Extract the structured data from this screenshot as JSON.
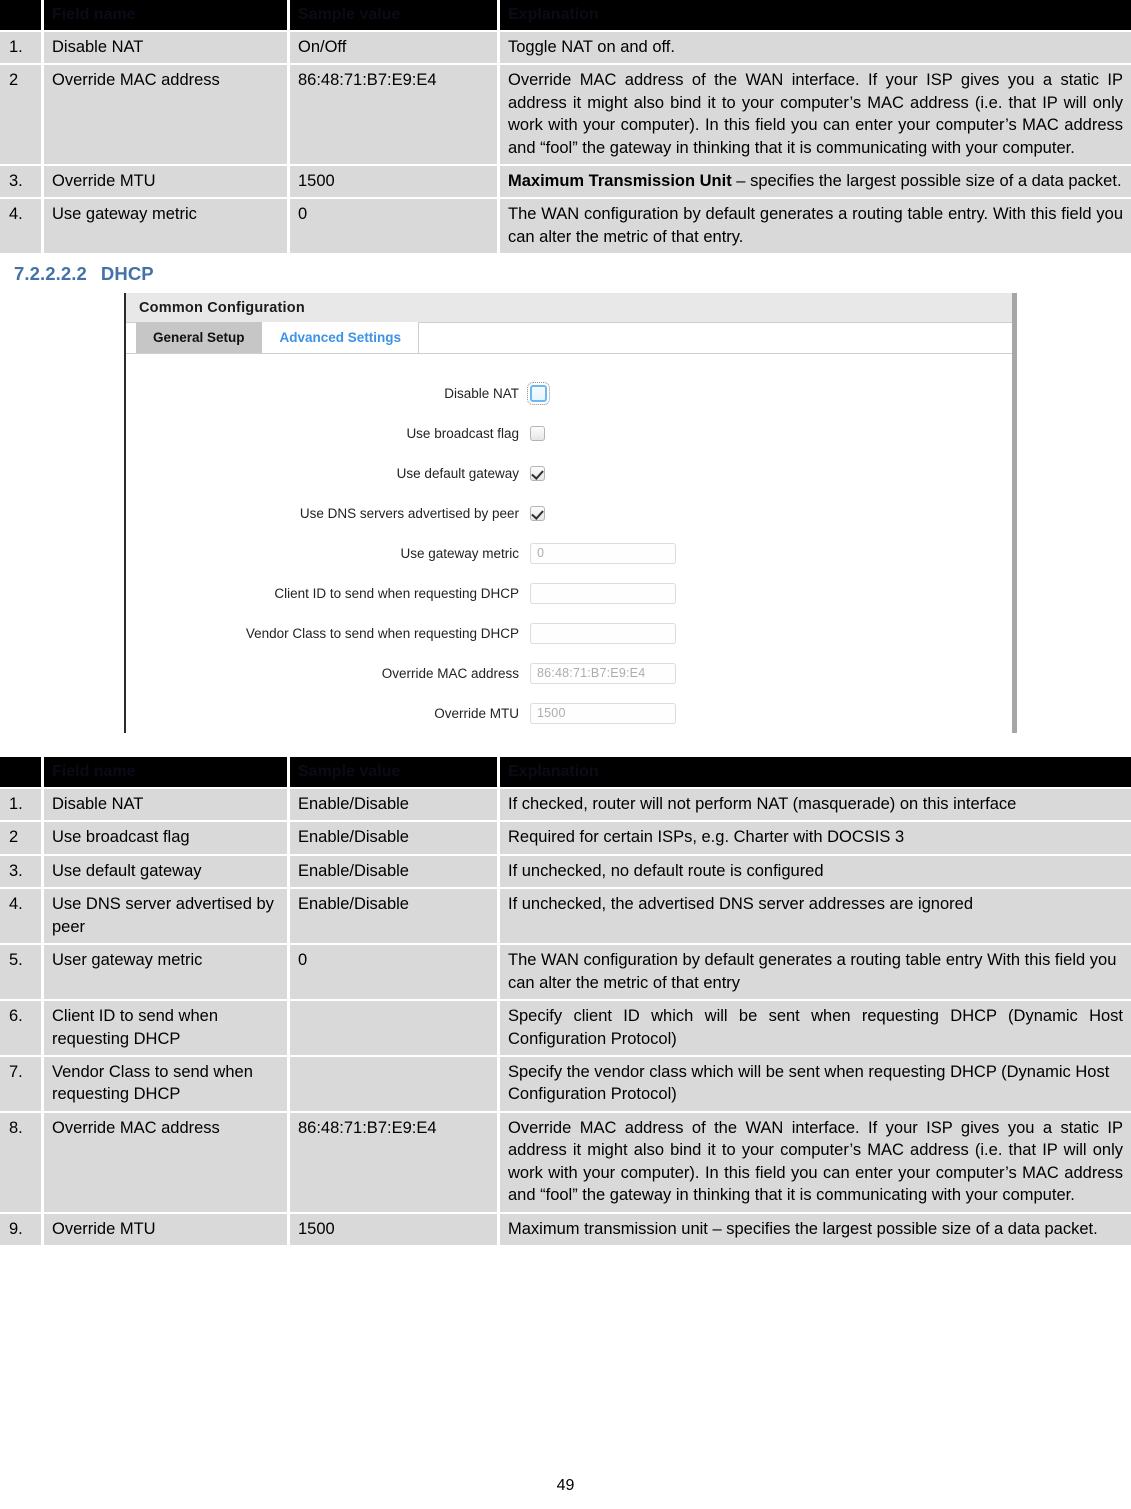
{
  "table_headers": {
    "num": "",
    "field_name": "Field name",
    "sample_value": "Sample value",
    "explanation": "Explanation"
  },
  "table_static": {
    "rows": [
      {
        "num": "1.",
        "field_name": "Disable NAT",
        "sample_value": "On/Off",
        "explanation": "Toggle NAT on and off."
      },
      {
        "num": "2",
        "field_name": "Override MAC address",
        "sample_value": "86:48:71:B7:E9:E4",
        "explanation": "Override MAC address of the WAN interface. If your ISP gives you a static IP address it might also bind it to your computer’s MAC address (i.e. that IP will only work with your computer). In this field you can enter your computer’s MAC address and “fool” the gateway in thinking that it is communicating with your computer."
      },
      {
        "num": "3.",
        "field_name": "Override MTU",
        "sample_value": "1500",
        "explanation_bold": "Maximum Transmission Unit",
        "explanation": " – specifies the largest possible size of a data packet."
      },
      {
        "num": "4.",
        "field_name": "Use gateway metric",
        "sample_value": "0",
        "explanation": "The WAN configuration by default generates a routing table entry. With this field you can alter the metric of that entry."
      }
    ]
  },
  "section": {
    "number": "7.2.2.2.2",
    "title": "DHCP",
    "heading_color": "#4472A8"
  },
  "screenshot": {
    "panel_title": "Common Configuration",
    "tabs": [
      {
        "label": "General Setup",
        "active": false
      },
      {
        "label": "Advanced Settings",
        "active": true
      }
    ],
    "active_tab_color": "#3b93e8",
    "fields": [
      {
        "label": "Disable NAT",
        "type": "checkbox",
        "checked": false,
        "focused": true
      },
      {
        "label": "Use broadcast flag",
        "type": "checkbox",
        "checked": false,
        "focused": false
      },
      {
        "label": "Use default gateway",
        "type": "checkbox",
        "checked": true,
        "focused": false
      },
      {
        "label": "Use DNS servers advertised by peer",
        "type": "checkbox",
        "checked": true,
        "focused": false
      },
      {
        "label": "Use gateway metric",
        "type": "text",
        "value": "0"
      },
      {
        "label": "Client ID to send when requesting DHCP",
        "type": "text",
        "value": ""
      },
      {
        "label": "Vendor Class to send when requesting DHCP",
        "type": "text",
        "value": ""
      },
      {
        "label": "Override MAC address",
        "type": "text",
        "value": "86:48:71:B7:E9:E4"
      },
      {
        "label": "Override MTU",
        "type": "text",
        "value": "1500"
      }
    ]
  },
  "table_dhcp": {
    "rows": [
      {
        "num": "1.",
        "field_name": "Disable NAT",
        "sample_value": "Enable/Disable",
        "explanation": "If checked, router will not perform NAT (masquerade) on this interface"
      },
      {
        "num": "2",
        "field_name": "Use broadcast flag",
        "sample_value": "Enable/Disable",
        "explanation": "Required for certain ISPs, e.g. Charter with DOCSIS 3"
      },
      {
        "num": "3.",
        "field_name": "Use default gateway",
        "sample_value": "Enable/Disable",
        "explanation": "If unchecked, no default route is configured"
      },
      {
        "num": "4.",
        "field_name": "Use DNS server advertised by peer",
        "sample_value": "Enable/Disable",
        "explanation": "If unchecked, the advertised DNS server addresses are ignored"
      },
      {
        "num": "5.",
        "field_name": "User gateway metric",
        "sample_value": "0",
        "explanation": "The WAN configuration by default generates a routing table entry With this field you can alter the metric of that entry"
      },
      {
        "num": "6.",
        "field_name": "Client ID to send when requesting DHCP",
        "sample_value": "",
        "explanation": "Specify client ID which will be sent when requesting DHCP (Dynamic Host Configuration Protocol)"
      },
      {
        "num": "7.",
        "field_name": "Vendor Class to send when requesting DHCP",
        "sample_value": "",
        "explanation": "Specify the vendor class which will be sent when requesting DHCP (Dynamic Host Configuration Protocol)"
      },
      {
        "num": "8.",
        "field_name": "Override MAC address",
        "sample_value": "86:48:71:B7:E9:E4",
        "explanation": "Override MAC address of the WAN interface. If your ISP gives you a static IP address it might also bind it to your computer’s MAC address (i.e. that IP will only work with your computer). In this field you can enter your computer’s MAC address and “fool” the gateway in thinking that it is communicating with your computer."
      },
      {
        "num": "9.",
        "field_name": "Override MTU",
        "sample_value": "1500",
        "explanation": "Maximum transmission unit – specifies the largest possible size of a data packet."
      }
    ]
  },
  "footer": {
    "page_number": "49"
  }
}
